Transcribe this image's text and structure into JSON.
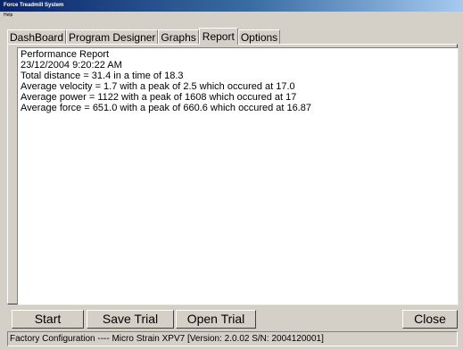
{
  "window": {
    "title": "Force Treadmill System"
  },
  "menubar": {
    "items": [
      "Help"
    ]
  },
  "tabs": [
    {
      "label": "DashBoard",
      "active": false
    },
    {
      "label": "Program Designer",
      "active": false
    },
    {
      "label": "Graphs",
      "active": false
    },
    {
      "label": "Report",
      "active": true
    },
    {
      "label": "Options",
      "active": false
    }
  ],
  "report": {
    "lines": [
      "Performance Report",
      "23/12/2004 9:20:22 AM",
      "Total distance = 31.4 in a time of 18.3",
      "Average velocity = 1.7 with a peak of 2.5 which occured at 17.0",
      "Average power = 1122 with a peak of 1608 which occured at 17",
      "Average force = 651.0 with a peak of 660.6 which occured at 16.87"
    ]
  },
  "buttons": {
    "start": "Start",
    "save_trial": "Save Trial",
    "open_trial": "Open Trial",
    "close": "Close"
  },
  "status": {
    "text": "Factory Configuration  ----  Micro Strain XPV7 [Version: 2.0.02 S/N: 2004120001]"
  }
}
